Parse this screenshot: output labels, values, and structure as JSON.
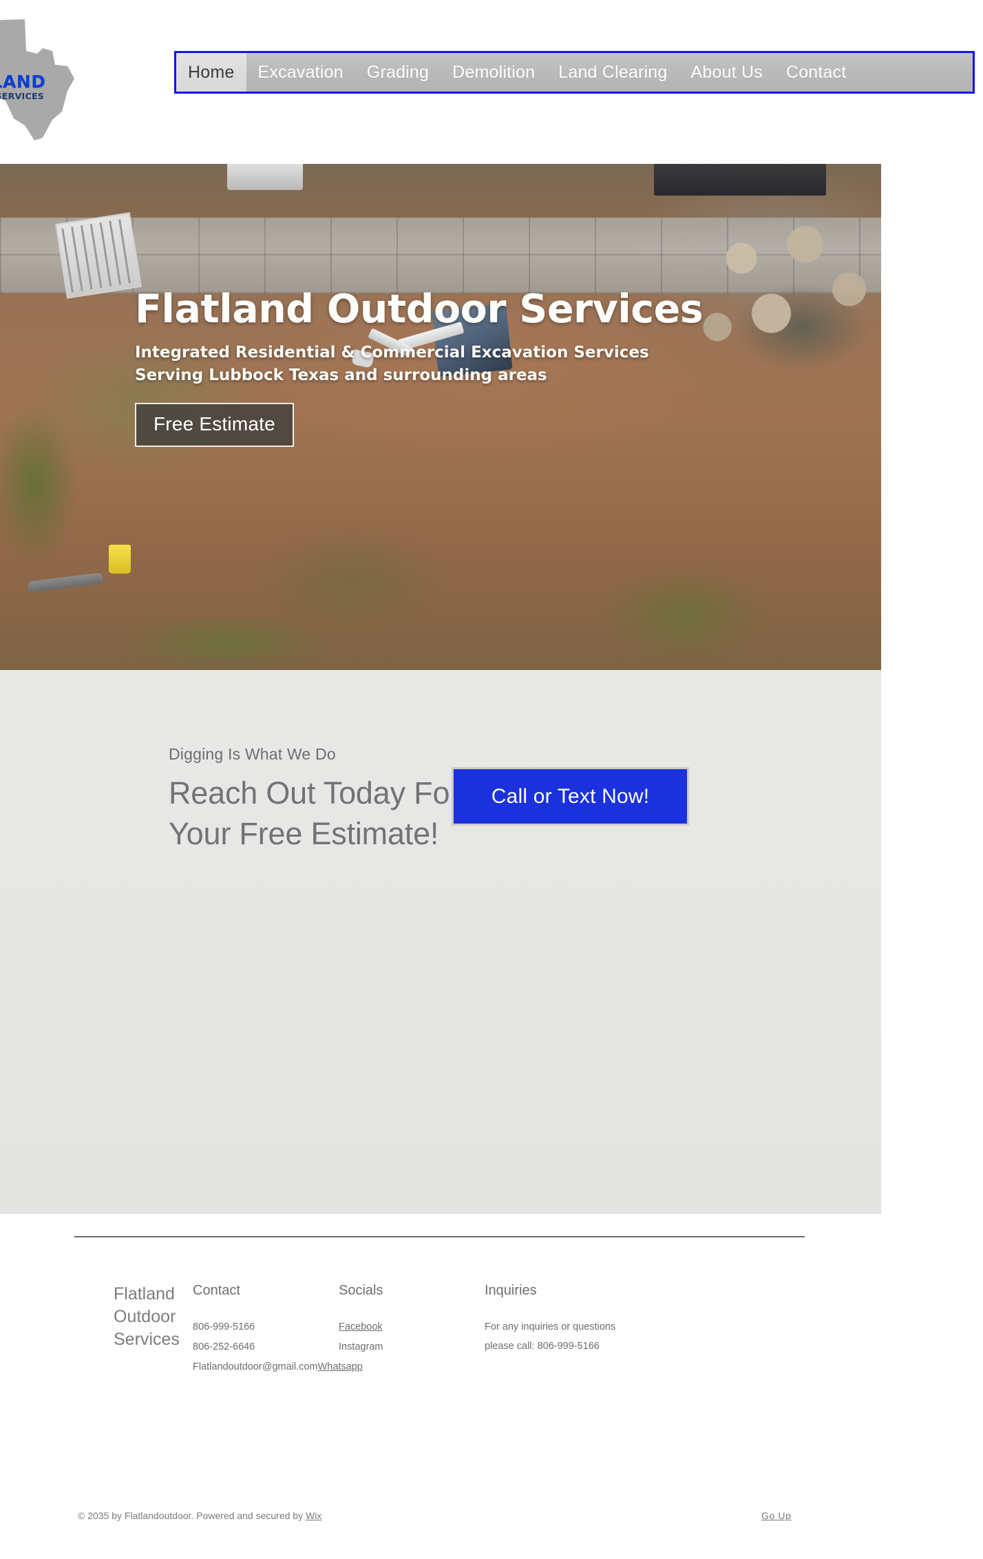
{
  "header": {
    "logo": {
      "icon": "texas-state-outline",
      "main_text": "TLAND",
      "sub_text": "OR SERVICES"
    },
    "nav": [
      {
        "label": "Home",
        "active": true
      },
      {
        "label": "Excavation",
        "active": false
      },
      {
        "label": "Grading",
        "active": false
      },
      {
        "label": "Demolition",
        "active": false
      },
      {
        "label": "Land Clearing",
        "active": false
      },
      {
        "label": "About Us",
        "active": false
      },
      {
        "label": "Contact",
        "active": false
      }
    ]
  },
  "hero": {
    "title": "Flatland Outdoor Services",
    "subtitle_line1": "Integrated Residential & Commercial Excavation Services",
    "subtitle_line2": "Serving Lubbock Texas and surrounding areas",
    "button_label": "Free Estimate"
  },
  "cta": {
    "kicker": "Digging Is What We Do",
    "heading": "Reach Out Today For Your Free Estimate!",
    "button_label": "Call or Text Now!",
    "button_color": "#1a31dd"
  },
  "footer": {
    "brand": "Flatland Outdoor Services",
    "columns": [
      {
        "title": "Contact",
        "lines": [
          "806-999-5166",
          "806-252-6646",
          "Flatlandoutdoor@gmail.com"
        ],
        "link": "Whatsapp"
      },
      {
        "title": "Socials",
        "lines": [
          "Facebook",
          "Instagram"
        ]
      },
      {
        "title": "Inquiries",
        "lines": [
          "For any inquiries or questions please call: 806-999-5166"
        ]
      }
    ],
    "copyright_text": "© 2035 by Flatlandoutdoor. Powered and secured by ",
    "copyright_link": "Wix",
    "go_up_label": "Go Up"
  }
}
